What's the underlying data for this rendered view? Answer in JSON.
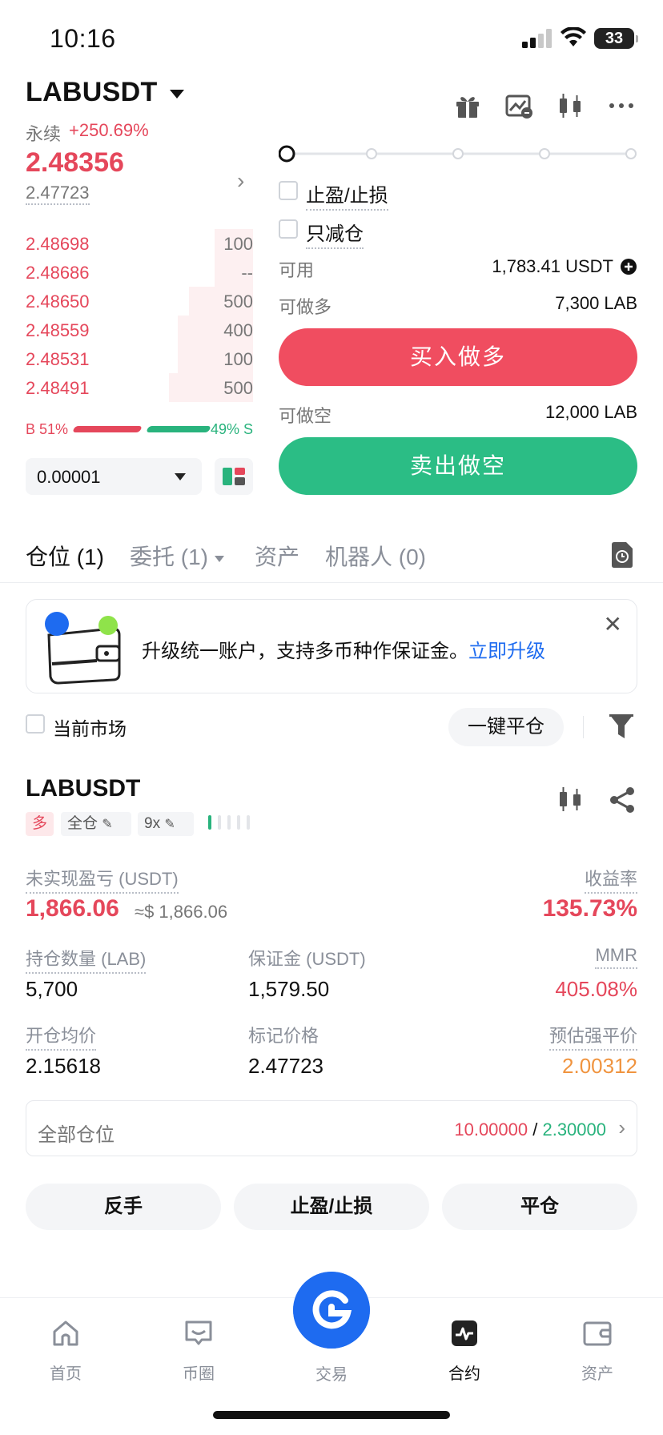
{
  "status_bar": {
    "time": "10:16",
    "battery": "33"
  },
  "header": {
    "pair": "LABUSDT",
    "perp_label": "永续",
    "change": "+250.69%",
    "last_price": "2.48356",
    "mark_price": "2.47723",
    "icons": [
      "gift-icon",
      "price-alert-icon",
      "kline-icon",
      "more-icon"
    ]
  },
  "order_book": {
    "asks": [
      {
        "price": "2.48698",
        "size": "100",
        "depth": 0.17
      },
      {
        "price": "2.48686",
        "size": "--",
        "depth": 0.17
      },
      {
        "price": "2.48650",
        "size": "500",
        "depth": 0.28
      },
      {
        "price": "2.48559",
        "size": "400",
        "depth": 0.33
      },
      {
        "price": "2.48531",
        "size": "100",
        "depth": 0.33
      },
      {
        "price": "2.48491",
        "size": "500",
        "depth": 0.37
      }
    ],
    "buy_ratio_label": "B 51%",
    "sell_ratio_label": "49% S",
    "buy_ratio": 0.51,
    "precision": "0.00001"
  },
  "order_form": {
    "leverage_slider_steps": 5,
    "leverage_slider_position": 0,
    "tpsl_label": "止盈/止损",
    "reduce_only_label": "只减仓",
    "available_label": "可用",
    "available_value": "1,783.41 USDT",
    "max_long_label": "可做多",
    "max_long_value": "7,300 LAB",
    "buy_button": "买入做多",
    "max_short_label": "可做空",
    "max_short_value": "12,000 LAB",
    "sell_button": "卖出做空"
  },
  "tabs": {
    "positions": "仓位 (1)",
    "orders": "委托 (1)",
    "assets": "资产",
    "bots": "机器人 (0)"
  },
  "banner": {
    "text": "升级统一账户，支持多币种作保证金。",
    "link": "立即升级",
    "close": "✕"
  },
  "filters": {
    "current_market": "当前市场",
    "close_all": "一键平仓"
  },
  "position": {
    "symbol": "LABUSDT",
    "side_tag": "多",
    "margin_mode": "全仓",
    "leverage": "9x",
    "upnl_label": "未实现盈亏 (USDT)",
    "upnl_value": "1,866.06",
    "upnl_usd": "≈$ 1,866.06",
    "roi_label": "收益率",
    "roi_value": "135.73%",
    "size_label": "持仓数量 (LAB)",
    "size_value": "5,700",
    "margin_label": "保证金 (USDT)",
    "margin_value": "1,579.50",
    "mmr_label": "MMR",
    "mmr_value": "405.08%",
    "entry_label": "开仓均价",
    "entry_value": "2.15618",
    "mark_label": "标记价格",
    "mark_value": "2.47723",
    "liq_label": "预估强平价",
    "liq_value": "2.00312",
    "all_positions_label": "全部仓位",
    "all_positions_tp": "10.00000",
    "all_positions_sep": " / ",
    "all_positions_sl": "2.30000",
    "reverse_button": "反手",
    "tpsl_button": "止盈/止损",
    "close_button": "平仓"
  },
  "bottom_nav": {
    "home": "首页",
    "feed": "币圈",
    "trade": "交易",
    "futures": "合约",
    "assets": "资产"
  },
  "colors": {
    "up": "#29b37d",
    "down": "#e5475b",
    "accent": "#1e6bf0",
    "liq": "#f0943f"
  }
}
